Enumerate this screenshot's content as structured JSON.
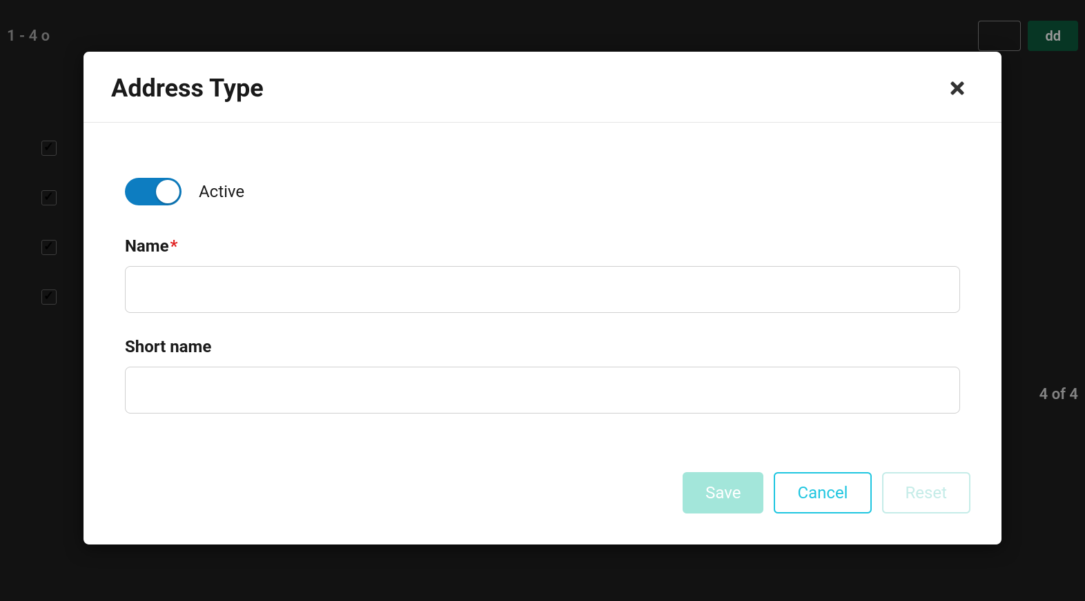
{
  "background": {
    "range_text": "1 - 4 o",
    "add_label": "dd",
    "footer_text": "4 of 4"
  },
  "modal": {
    "title": "Address Type",
    "toggle_label": "Active",
    "toggle_active": true,
    "fields": {
      "name": {
        "label": "Name",
        "required": "*",
        "value": ""
      },
      "short_name": {
        "label": "Short name",
        "value": ""
      }
    },
    "buttons": {
      "save": "Save",
      "cancel": "Cancel",
      "reset": "Reset"
    }
  }
}
